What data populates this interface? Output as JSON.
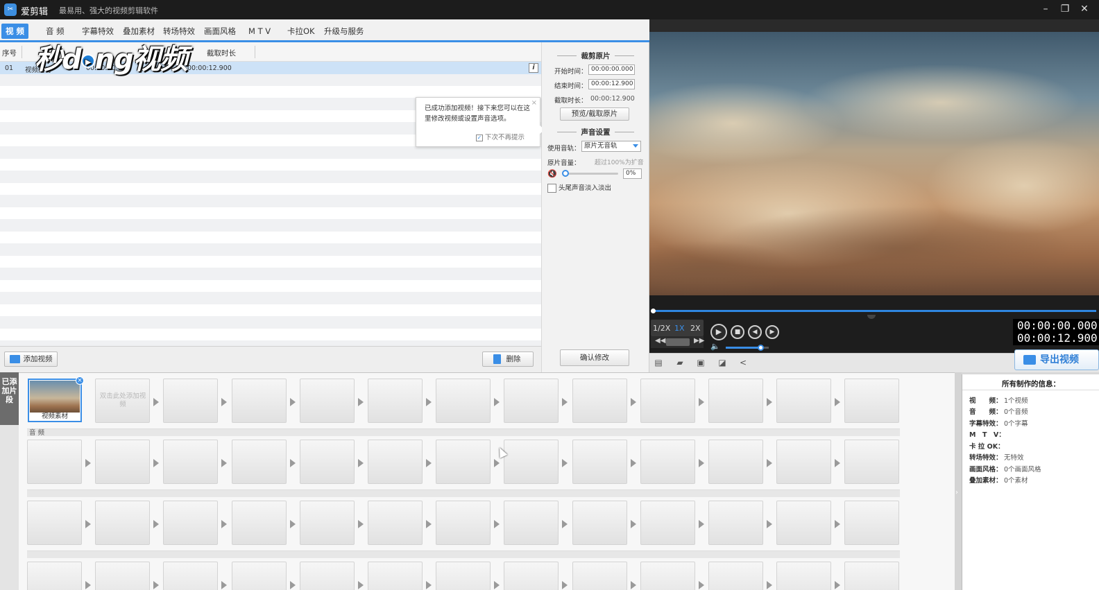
{
  "titlebar": {
    "app_name": "爱剪辑",
    "slogan": "最易用、强大的视频剪辑软件",
    "minimize": "–",
    "restore": "❐",
    "close": "✕"
  },
  "menu": {
    "tabs": [
      {
        "label": "视 频",
        "active": true
      },
      {
        "label": "音 频"
      },
      {
        "label": "字幕特效"
      },
      {
        "label": "叠加素材"
      },
      {
        "label": "转场特效"
      },
      {
        "label": "画面风格"
      },
      {
        "label": "M T V"
      },
      {
        "label": "卡拉OK"
      },
      {
        "label": "升级与服务"
      }
    ]
  },
  "watermark": {
    "text_1": "秒d",
    "dot": "▶",
    "text_2": "ng视频"
  },
  "clip_list": {
    "headers": {
      "index": "序号",
      "duration": "截取时长"
    },
    "rows": [
      {
        "index": "01",
        "name": "视频素材",
        "time": "00:00:00.000",
        "duration": "00:00:12.900"
      }
    ],
    "info_icon": "i"
  },
  "tooltip": {
    "text": "已成功添加视频！接下来您可以在这里修改视频或设置声音选项。",
    "checkbox_label": "下次不再提示",
    "checkbox_checked": true,
    "close": "×"
  },
  "list_footer": {
    "add_video": "添加视频",
    "delete": "删除"
  },
  "settings": {
    "clip_title": "裁剪原片",
    "start_label": "开始时间：",
    "start_value": "00:00:00.000",
    "end_label": "结束时间：",
    "end_value": "00:00:12.900",
    "duration_label": "截取时长：",
    "duration_value": "00:00:12.900",
    "preview_button": "预览/截取原片",
    "audio_title": "声音设置",
    "track_label": "使用音轨：",
    "track_value": "原片无音轨",
    "volume_label": "原片音量：",
    "volume_hint": "超过100%为扩音",
    "volume_value": "0%",
    "volume_level": 0,
    "fade_label": "头尾声音淡入淡出",
    "fade_checked": false,
    "confirm_button": "确认修改"
  },
  "player": {
    "speeds": [
      "1/2X",
      "1X",
      "2X"
    ],
    "active_speed": "1X",
    "current_time": "00:00:00.000",
    "total_time": "00:00:12.900",
    "progress": 0,
    "volume_level": 0.8,
    "export_button": "导出视频"
  },
  "timeline": {
    "side_tab": "已添加片段",
    "clip_label": "视频素材",
    "add_hint": "双击此处添加视频",
    "audio_label": "音 频",
    "slots_per_row": 13
  },
  "info_panel": {
    "title": "所有制作的信息：",
    "items": [
      {
        "key": "视　　频：",
        "value": "1个视频"
      },
      {
        "key": "音　　频：",
        "value": "0个音频"
      },
      {
        "key": "字幕特效：",
        "value": "0个字幕"
      },
      {
        "key": "M　T　V：",
        "value": ""
      },
      {
        "key": "卡 拉 OK：",
        "value": ""
      },
      {
        "key": "转场特效：",
        "value": "无特效"
      },
      {
        "key": "画面风格：",
        "value": "0个画面风格"
      },
      {
        "key": "叠加素材：",
        "value": "0个素材"
      }
    ]
  },
  "colors": {
    "accent": "#3a8ee6",
    "titlebar": "#1c1c1c",
    "selected_row": "#cde2f7"
  }
}
